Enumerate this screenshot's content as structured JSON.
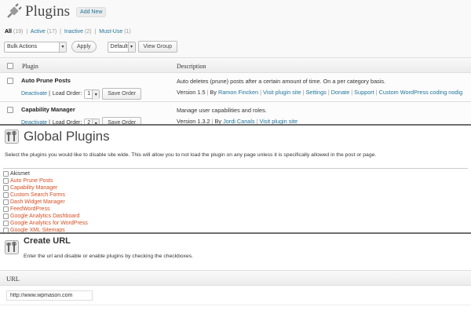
{
  "plugins_page": {
    "title": "Plugins",
    "add_new_label": "Add New",
    "filters": [
      {
        "label": "All",
        "count": "(19)"
      },
      {
        "label": "Active",
        "count": "(17)"
      },
      {
        "label": "Inactive",
        "count": "(2)"
      },
      {
        "label": "Must-Use",
        "count": "(1)"
      }
    ],
    "bulk_actions_value": "Bulk Actions",
    "apply_label": "Apply",
    "default_value": "Default",
    "view_group_label": "View Group",
    "columns": {
      "plugin": "Plugin",
      "description": "Description"
    },
    "rows": [
      {
        "name": "Auto Prune Posts",
        "deactivate": "Deactivate",
        "load_order_label": "Load Order:",
        "load_order_value": "1",
        "save_order": "Save Order",
        "description": "Auto deletes (prune) posts after a certain amount of time. On a per category basis.",
        "version": "Version 1.5",
        "by": "By",
        "author": "Ramon Fincken",
        "links": [
          "Visit plugin site",
          "Settings",
          "Donate",
          "Support",
          "Custom WordPress coding nodig"
        ]
      },
      {
        "name": "Capability Manager",
        "deactivate": "Deactivate",
        "load_order_label": "Load Order:",
        "load_order_value": "2",
        "save_order": "Save Order",
        "description": "Manage user capabilities and roles.",
        "version": "Version 1.3.2",
        "by": "By",
        "author": "Jordi Canals",
        "links": [
          "Visit plugin site"
        ]
      }
    ]
  },
  "global_plugins": {
    "title": "Global Plugins",
    "intro": "Select the plugins you would like to disable site wide. This will allow you to not load the plugin on any page unless it is specifically allowed in the post or page.",
    "items": [
      {
        "label": "Akismet",
        "style": "plain"
      },
      {
        "label": "Auto Prune Posts",
        "style": "link"
      },
      {
        "label": "Capability Manager",
        "style": "link"
      },
      {
        "label": "Custom Search Forms",
        "style": "link"
      },
      {
        "label": "Dash Widget Manager",
        "style": "link"
      },
      {
        "label": "FeedWordPress",
        "style": "link"
      },
      {
        "label": "Google Analytics Dashboard",
        "style": "link"
      },
      {
        "label": "Google Analytics for WordPress",
        "style": "link"
      },
      {
        "label": "Google XML Sitemaps",
        "style": "link"
      }
    ]
  },
  "create_url": {
    "title": "Create URL",
    "intro": "Enter the url and disable or enable plugins by checking the checkboxes.",
    "url_label": "URL",
    "url_value": "http://www.wpmason.com"
  },
  "colors": {
    "link": "#21759b",
    "plugin_link": "#d54e21",
    "divider": "#6e6e6e"
  },
  "icons": [
    "plugin-plug-icon",
    "tools-icon",
    "select-arrow-icon"
  ]
}
